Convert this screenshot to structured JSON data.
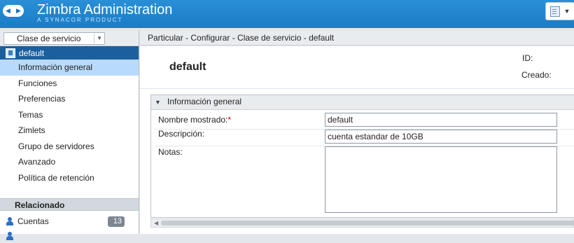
{
  "header": {
    "brand_title": "Zimbra Administration",
    "brand_subtitle": "A SYNACOR PRODUCT"
  },
  "sidebar": {
    "section_select": "Clase de servicio",
    "selected_item": "default",
    "items": [
      {
        "label": "Información general",
        "active": true
      },
      {
        "label": "Funciones",
        "active": false
      },
      {
        "label": "Preferencias",
        "active": false
      },
      {
        "label": "Temas",
        "active": false
      },
      {
        "label": "Zimlets",
        "active": false
      },
      {
        "label": "Grupo de servidores",
        "active": false
      },
      {
        "label": "Avanzado",
        "active": false
      },
      {
        "label": "Política de retención",
        "active": false
      }
    ],
    "related": {
      "heading": "Relacionado",
      "items": [
        {
          "label": "Cuentas",
          "count": "13"
        }
      ]
    }
  },
  "breadcrumb": "Particular - Configurar - Clase de servicio - default",
  "main": {
    "title": "default",
    "id_label": "ID:",
    "created_label": "Creado:",
    "section_title": "Información general",
    "fields": {
      "display_name_label": "Nombre mostrado:",
      "display_name_required": "*",
      "display_name_value": "default",
      "description_label": "Descripción:",
      "description_value": "cuenta estandar de 10GB",
      "notes_label": "Notas:",
      "notes_value": ""
    }
  },
  "colors": {
    "header_blue": "#1a7cc6",
    "selected_tree": "#1b5f9e",
    "active_item": "#b9dbfb"
  }
}
